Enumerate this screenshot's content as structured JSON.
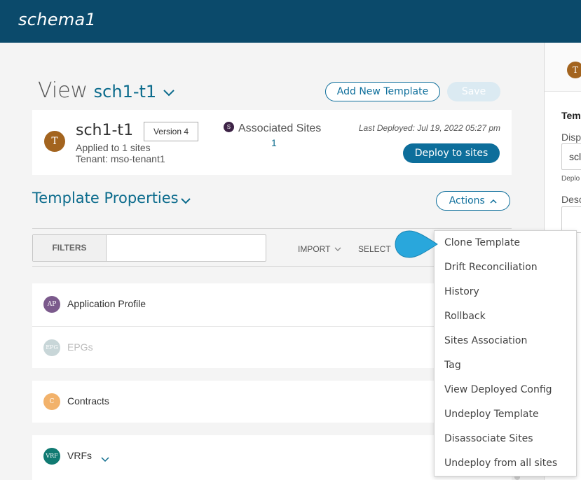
{
  "window": {
    "title": "schema1"
  },
  "view": {
    "label": "View",
    "template_name": "sch1-t1"
  },
  "header_buttons": {
    "add_template": "Add New Template",
    "save": "Save"
  },
  "template_card": {
    "avatar_letter": "T",
    "name": "sch1-t1",
    "version": "Version 4",
    "applied": "Applied to 1 sites",
    "tenant": "Tenant: mso-tenant1",
    "associated_sites_badge": "S",
    "associated_sites_label": "Associated Sites",
    "associated_sites_count": "1",
    "last_deployed": "Last Deployed: Jul 19, 2022 05:27 pm",
    "deploy_button": "Deploy to sites"
  },
  "template_properties": {
    "title": "Template Properties",
    "actions_button": "Actions"
  },
  "toolbar": {
    "filters": "FILTERS",
    "filter_value": "",
    "import": "IMPORT",
    "select": "SELECT"
  },
  "sections": [
    {
      "badge": "AP",
      "label": "Application Profile",
      "color": "#7b5a8c"
    },
    {
      "badge": "EPG",
      "label": "EPGs",
      "color": "#c8d6d8"
    },
    {
      "badge": "C",
      "label": "Contracts",
      "color": "#f2b26b"
    },
    {
      "badge": "VRF",
      "label": "VRFs",
      "color": "#107a72"
    }
  ],
  "actions_menu": [
    "Clone Template",
    "Drift Reconciliation",
    "History",
    "Rollback",
    "Sites Association",
    "Tag",
    "View Deployed Config",
    "Undeploy Template",
    "Disassociate Sites",
    "Undeploy from all sites"
  ],
  "right_panel": {
    "avatar_letter": "T",
    "section_title": "Tem",
    "display_label": "Disp",
    "display_value": "scl",
    "deploy_note": "Deplo",
    "description_label": "Desc"
  },
  "colors": {
    "header": "#0b4a6b",
    "accent": "#0d6e9b",
    "callout": "#29a7dc"
  }
}
